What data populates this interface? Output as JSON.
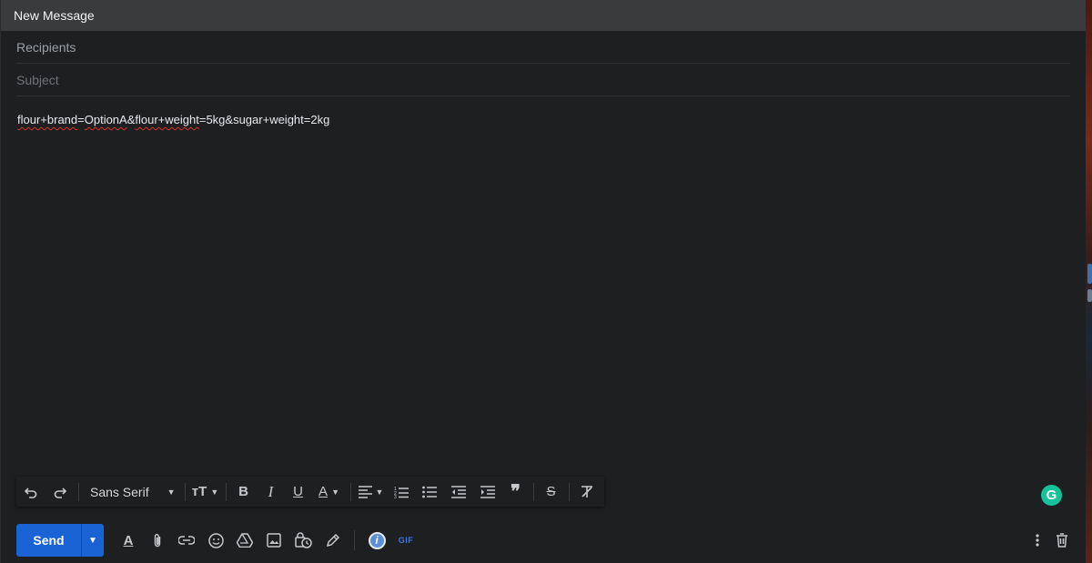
{
  "compose": {
    "title": "New Message",
    "recipients_placeholder": "Recipients",
    "subject_placeholder": "Subject",
    "body": {
      "part1": "flour+brand",
      "part2": "=",
      "part3": "OptionA",
      "part4": "&",
      "part5": "flour+weight",
      "part6": "=5kg&sugar+weight=2kg"
    }
  },
  "formatting": {
    "font": "Sans Serif"
  },
  "footer": {
    "send_label": "Send",
    "gif_label": "GIF"
  },
  "colors": {
    "send_button": "#1a63d5",
    "grammarly": "#15c39a",
    "spellcheck_underline": "#d93025"
  }
}
